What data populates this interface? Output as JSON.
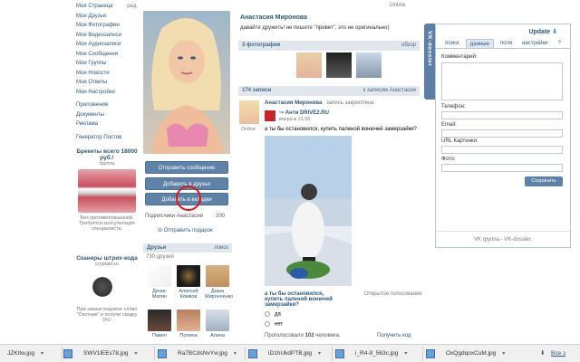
{
  "leftnav": {
    "edit_label": "ред.",
    "items": [
      "Моя Страница",
      "Мои Друзья",
      "Мои Фотографии",
      "Мои Видеозаписи",
      "Мои Аудиозаписи",
      "Мои Сообщения",
      "Мои Группы",
      "Мои Новости",
      "Мои Ответы",
      "Мои Настройки"
    ],
    "items2": [
      "Приложения",
      "Документы",
      "Реклама"
    ],
    "items3": [
      "Генератор Постов"
    ]
  },
  "ads": {
    "ad1_title": "Брекеты всего 18000 руб.!",
    "ad1_sub": "группа",
    "ad1_text": "Без противопоказаний. Требуется консультация специалиста.",
    "ad2_title": "Сканеры штрих-кода",
    "ad2_sub": "cryptakr.ru",
    "ad2_text": "При заказе кодовое слово \"Охотник\" и получи скидку 5%!"
  },
  "profile": {
    "name_header": "Анастасия Миронова",
    "status_online": "Online",
    "btn_message": "Отправить сообщение",
    "btn_add_friend": "Добавить в друзья",
    "btn_add_bookmarks": "Добавить в вкладки",
    "followers_label": "Подписчики Анастасии",
    "followers_count": "200",
    "gift_label": "Отправить подарок",
    "friends_header": "Друзья",
    "friends_extra": "поиск",
    "friends_count": "730 друзей",
    "friends": [
      {
        "name": "Денис Матин"
      },
      {
        "name": "Алексей Комков"
      },
      {
        "name": "Даша Миронченко"
      },
      {
        "name": "Павел"
      },
      {
        "name": "Полина"
      },
      {
        "name": "Алина"
      }
    ]
  },
  "main": {
    "name": "Анастасия Миронова",
    "status_text": "давайте дружить! не пишите \"привет\", это не оригинально)",
    "photos_header": "3 фотографии",
    "photos_extra": "обзор",
    "posts_count": "174 записи",
    "posts_link": "к записям Анастасии",
    "post": {
      "author": "Анастасия Миронова",
      "pinned": "запись закреплена",
      "repost_source": "Анти DRIVE2.RU",
      "repost_time": "вчера в 21:00",
      "online": "Online",
      "text": "а ты бы остановился, купить паленой вонючей замерзайки?",
      "poll_question": "а ты бы остановился, купить паленой вонючей замерзайки?",
      "poll_type": "Открытое голосование",
      "option_yes": "да",
      "option_no": "нет",
      "voted_prefix": "Проголосовало",
      "voted_count": "102",
      "voted_suffix": "человека.",
      "results_link": "Получить код"
    }
  },
  "widget": {
    "tab_label": "VK-dossier",
    "update_label": "Update",
    "tabs": [
      "поиск",
      "данные",
      "поля",
      "настройки"
    ],
    "active_tab": "данные",
    "help": "?",
    "fields": [
      "Комментарий:",
      "Телефон:",
      "Email:",
      "URL Картинки:",
      "Фото:"
    ],
    "save_label": "Сохранить",
    "footer": "VK группа - VK-dossier."
  },
  "taskbar": {
    "downloads": [
      "JZKItw.jpg",
      "SWV1lEEs78.jpg",
      "Ra7BCdsNvYw.jpg",
      "iD1hUkdPTB.jpg",
      "i_R4-9_563c.jpg",
      "OxQgdqoxCuM.jpg"
    ],
    "show_all": "Все з"
  },
  "colors": {
    "vk_blue": "#5e82a8",
    "link": "#2b587a",
    "header_bg": "#e1e7ed"
  }
}
